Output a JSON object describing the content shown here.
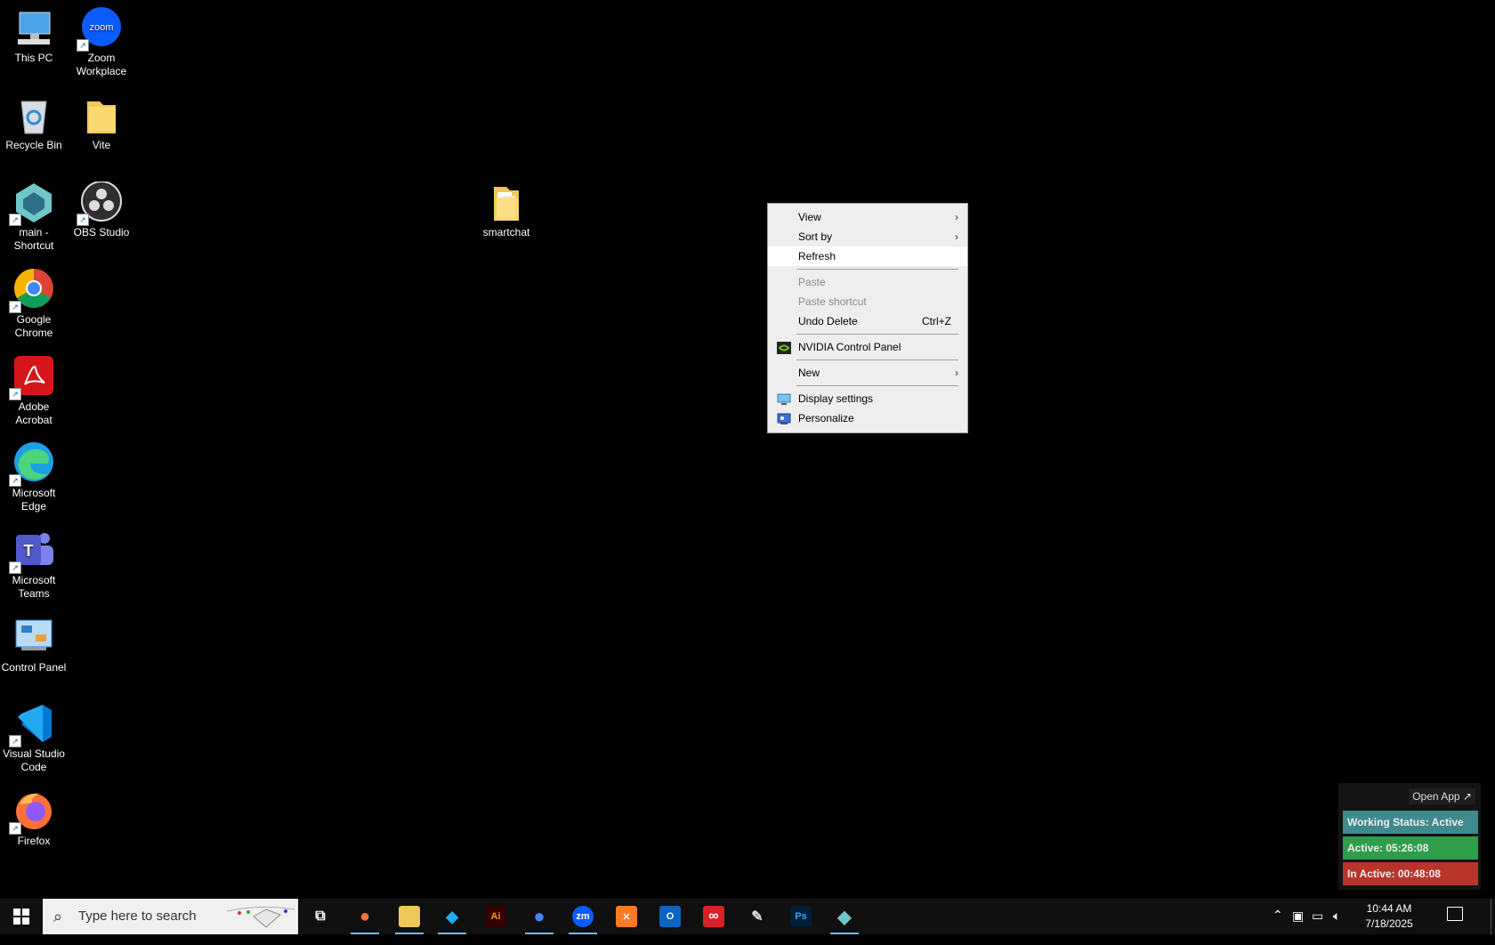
{
  "desktop": {
    "icons": [
      {
        "label": "This PC"
      },
      {
        "label": "Zoom Workplace"
      },
      {
        "label": "Recycle Bin"
      },
      {
        "label": "Vite"
      },
      {
        "label": "main - Shortcut"
      },
      {
        "label": "OBS Studio"
      },
      {
        "label": "Google Chrome"
      },
      {
        "label": "Adobe Acrobat"
      },
      {
        "label": "Microsoft Edge"
      },
      {
        "label": "Microsoft Teams"
      },
      {
        "label": "Control Panel"
      },
      {
        "label": "Visual Studio Code"
      },
      {
        "label": "Firefox"
      },
      {
        "label": "smartchat"
      }
    ],
    "zoom_logo_text": "zoom"
  },
  "context_menu": {
    "items": [
      {
        "label": "View"
      },
      {
        "label": "Sort by"
      },
      {
        "label": "Refresh"
      },
      {
        "label": "Paste"
      },
      {
        "label": "Paste shortcut"
      },
      {
        "label": "Undo Delete",
        "shortcut": "Ctrl+Z"
      },
      {
        "label": "NVIDIA Control Panel"
      },
      {
        "label": "New"
      },
      {
        "label": "Display settings"
      },
      {
        "label": "Personalize"
      }
    ],
    "submenu_glyph": "›"
  },
  "taskbar": {
    "search_placeholder": "Type here to search",
    "apps": [
      {
        "name": "task-view",
        "glyph": "⧉"
      },
      {
        "name": "firefox",
        "glyph": "●"
      },
      {
        "name": "file-explorer",
        "glyph": "▬"
      },
      {
        "name": "vscode",
        "glyph": "◆"
      },
      {
        "name": "illustrator",
        "glyph": "Ai"
      },
      {
        "name": "chrome",
        "glyph": "●"
      },
      {
        "name": "zoom",
        "glyph": "zm"
      },
      {
        "name": "xampp",
        "glyph": "✕"
      },
      {
        "name": "outlook",
        "glyph": "O"
      },
      {
        "name": "creative-cloud",
        "glyph": "∞"
      },
      {
        "name": "pen-tool",
        "glyph": "✎"
      },
      {
        "name": "photoshop",
        "glyph": "Ps"
      },
      {
        "name": "main-app",
        "glyph": "◆"
      }
    ],
    "tray": {
      "time": "10:44 AM",
      "date": "7/18/2025"
    }
  },
  "widget": {
    "open_app": "Open App ↗",
    "status": "Working Status: Active",
    "active": "Active: 05:26:08",
    "inactive": "In Active: 00:48:08"
  }
}
